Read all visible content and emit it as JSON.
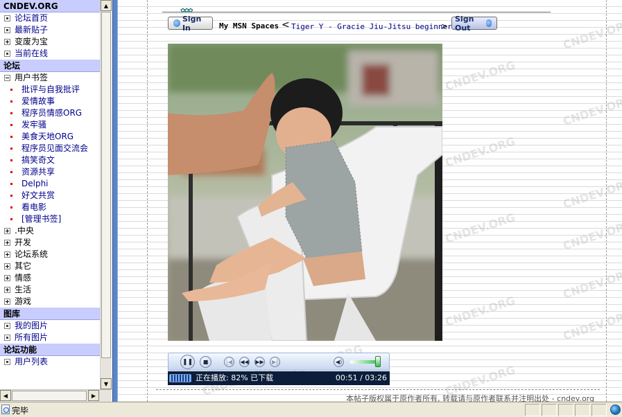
{
  "sidebar": {
    "sections": [
      {
        "title": "CNDEV.ORG",
        "items": [
          {
            "label": "论坛首页",
            "kind": "dot"
          },
          {
            "label": "最新贴子",
            "kind": "dot"
          },
          {
            "label": "变废为宝",
            "kind": "plus"
          },
          {
            "label": "当前在线",
            "kind": "dot"
          }
        ]
      },
      {
        "title": "论坛",
        "items": [
          {
            "label": "用户书签",
            "kind": "minus"
          },
          {
            "label": "批评与自我批评",
            "kind": "bullet"
          },
          {
            "label": "爱情故事",
            "kind": "bullet"
          },
          {
            "label": "程序员情感ORG",
            "kind": "bullet"
          },
          {
            "label": "发牢骚",
            "kind": "bullet"
          },
          {
            "label": "美食天地ORG",
            "kind": "bullet"
          },
          {
            "label": "程序员见面交流会",
            "kind": "bullet"
          },
          {
            "label": "搞笑奇文",
            "kind": "bullet"
          },
          {
            "label": "资源共享",
            "kind": "bullet"
          },
          {
            "label": "Delphi",
            "kind": "bullet"
          },
          {
            "label": "好文共赏",
            "kind": "bullet"
          },
          {
            "label": "看电影",
            "kind": "bullet"
          },
          {
            "label": "[管理书签]",
            "kind": "bullet"
          },
          {
            "label": ".中央",
            "kind": "plus"
          },
          {
            "label": "开发",
            "kind": "plus"
          },
          {
            "label": "论坛系统",
            "kind": "plus"
          },
          {
            "label": "其它",
            "kind": "plus"
          },
          {
            "label": "情感",
            "kind": "plus"
          },
          {
            "label": "生活",
            "kind": "plus"
          },
          {
            "label": "游戏",
            "kind": "plus"
          }
        ]
      },
      {
        "title": "图库",
        "items": [
          {
            "label": "我的图片",
            "kind": "dot"
          },
          {
            "label": "所有图片",
            "kind": "dot"
          }
        ]
      },
      {
        "title": "论坛功能",
        "items": [
          {
            "label": "用户列表",
            "kind": "dot"
          }
        ]
      }
    ]
  },
  "content": {
    "watermark": "CNDEV.ORG",
    "msn": {
      "signin_label": "Sign In",
      "title": "My MSN Spaces",
      "bracket_left": "<",
      "link": "Tiger Y - Gracie Jiu-Jitsu beginner",
      "bracket_right": ">",
      "signout_label": "Sign Out"
    },
    "player": {
      "status": "正在播放: 82% 已下载",
      "time": "00:51 / 03:26",
      "download_percent": 82
    },
    "copyright": "本帖子版权属于原作者所有, 转载请与原作者联系并注明出处 - cndev.org"
  },
  "statusbar": {
    "text": "完毕"
  },
  "icons": {
    "pause": "pause-icon",
    "stop": "stop-icon",
    "previous": "previous-icon",
    "rewind": "rewind-icon",
    "fast_forward": "fast-forward-icon",
    "next": "next-icon",
    "mute": "speaker-icon",
    "zone": "internet-zone-icon"
  }
}
